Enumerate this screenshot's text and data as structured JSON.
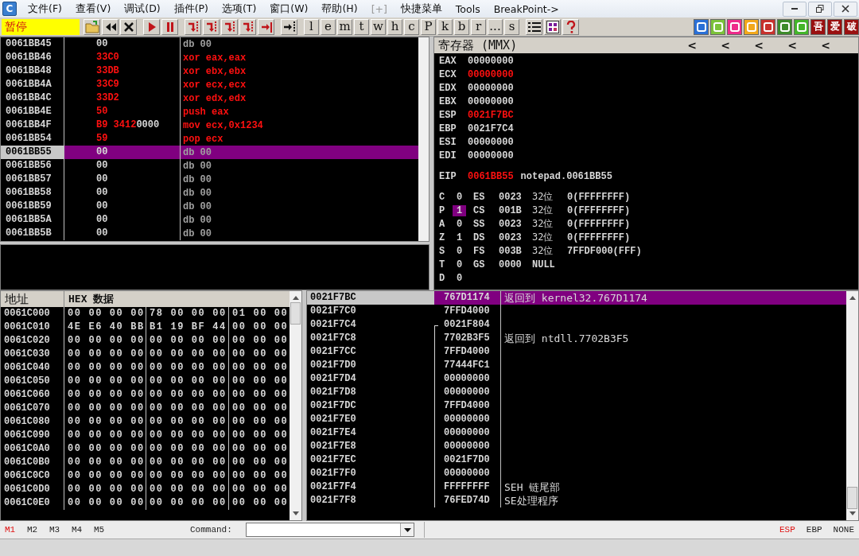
{
  "app_icon": "C",
  "menu": [
    {
      "label": "文件(F)",
      "disabled": false
    },
    {
      "label": "查看(V)",
      "disabled": false
    },
    {
      "label": "调试(D)",
      "disabled": false
    },
    {
      "label": "插件(P)",
      "disabled": false
    },
    {
      "label": "选项(T)",
      "disabled": false
    },
    {
      "label": "窗口(W)",
      "disabled": false
    },
    {
      "label": "帮助(H)",
      "disabled": false
    },
    {
      "label": "[+]",
      "disabled": true
    },
    {
      "label": "快捷菜单",
      "disabled": false
    },
    {
      "label": "Tools",
      "disabled": false
    },
    {
      "label": "BreakPoint->",
      "disabled": false
    }
  ],
  "toolbar": {
    "status": "暂停",
    "letter_buttons": [
      "l",
      "e",
      "m",
      "t",
      "w",
      "h",
      "c",
      "P",
      "k",
      "b",
      "r",
      "...",
      "s"
    ],
    "plugin_buttons": [
      "吾",
      "爱",
      "破"
    ]
  },
  "disassembly": {
    "rows": [
      {
        "address": "0061BB45",
        "hex": [
          {
            "text": "00",
            "modified": false
          }
        ],
        "instruction": "db 00",
        "modified": false,
        "selected": false
      },
      {
        "address": "0061BB46",
        "hex": [
          {
            "text": "33C0",
            "modified": true
          }
        ],
        "instruction": "xor eax,eax",
        "modified": true,
        "selected": false
      },
      {
        "address": "0061BB48",
        "hex": [
          {
            "text": "33DB",
            "modified": true
          }
        ],
        "instruction": "xor ebx,ebx",
        "modified": true,
        "selected": false
      },
      {
        "address": "0061BB4A",
        "hex": [
          {
            "text": "33C9",
            "modified": true
          }
        ],
        "instruction": "xor ecx,ecx",
        "modified": true,
        "selected": false
      },
      {
        "address": "0061BB4C",
        "hex": [
          {
            "text": "33D2",
            "modified": true
          }
        ],
        "instruction": "xor edx,edx",
        "modified": true,
        "selected": false
      },
      {
        "address": "0061BB4E",
        "hex": [
          {
            "text": "50",
            "modified": true
          }
        ],
        "instruction": "push eax",
        "modified": true,
        "selected": false
      },
      {
        "address": "0061BB4F",
        "hex": [
          {
            "text": "B9 3412",
            "modified": true
          },
          {
            "text": "0000",
            "modified": false
          }
        ],
        "instruction": "mov ecx,0x1234",
        "modified": true,
        "selected": false
      },
      {
        "address": "0061BB54",
        "hex": [
          {
            "text": "59",
            "modified": true
          }
        ],
        "instruction": "pop ecx",
        "modified": true,
        "selected": false
      },
      {
        "address": "0061BB55",
        "hex": [
          {
            "text": "00",
            "modified": false
          }
        ],
        "instruction": "db 00",
        "modified": false,
        "selected": true
      },
      {
        "address": "0061BB56",
        "hex": [
          {
            "text": "00",
            "modified": false
          }
        ],
        "instruction": "db 00",
        "modified": false,
        "selected": false
      },
      {
        "address": "0061BB57",
        "hex": [
          {
            "text": "00",
            "modified": false
          }
        ],
        "instruction": "db 00",
        "modified": false,
        "selected": false
      },
      {
        "address": "0061BB58",
        "hex": [
          {
            "text": "00",
            "modified": false
          }
        ],
        "instruction": "db 00",
        "modified": false,
        "selected": false
      },
      {
        "address": "0061BB59",
        "hex": [
          {
            "text": "00",
            "modified": false
          }
        ],
        "instruction": "db 00",
        "modified": false,
        "selected": false
      },
      {
        "address": "0061BB5A",
        "hex": [
          {
            "text": "00",
            "modified": false
          }
        ],
        "instruction": "db 00",
        "modified": false,
        "selected": false
      },
      {
        "address": "0061BB5B",
        "hex": [
          {
            "text": "00",
            "modified": false
          }
        ],
        "instruction": "db 00",
        "modified": false,
        "selected": false
      }
    ]
  },
  "registers": {
    "title": "寄存器 (MMX)",
    "arrows": [
      "<",
      "<",
      "<",
      "<",
      "<"
    ],
    "gprs": [
      {
        "name": "EAX",
        "value": "00000000",
        "changed": false
      },
      {
        "name": "ECX",
        "value": "00000000",
        "changed": true
      },
      {
        "name": "EDX",
        "value": "00000000",
        "changed": false
      },
      {
        "name": "EBX",
        "value": "00000000",
        "changed": false
      },
      {
        "name": "ESP",
        "value": "0021F7BC",
        "changed": true
      },
      {
        "name": "EBP",
        "value": "0021F7C4",
        "changed": false
      },
      {
        "name": "ESI",
        "value": "00000000",
        "changed": false
      },
      {
        "name": "EDI",
        "value": "00000000",
        "changed": false
      }
    ],
    "eip": {
      "name": "EIP",
      "value": "0061BB55",
      "changed": true,
      "comment": "notepad.0061BB55"
    },
    "flags": [
      {
        "name": "C",
        "value": "0",
        "changed": false
      },
      {
        "name": "P",
        "value": "1",
        "changed": true
      },
      {
        "name": "A",
        "value": "0",
        "changed": false
      },
      {
        "name": "Z",
        "value": "1",
        "changed": false
      },
      {
        "name": "S",
        "value": "0",
        "changed": false
      },
      {
        "name": "T",
        "value": "0",
        "changed": false
      },
      {
        "name": "D",
        "value": "0",
        "changed": false
      }
    ],
    "segments": [
      {
        "name": "ES",
        "selector": "0023",
        "bits": "32位",
        "base": "0(FFFFFFFF)"
      },
      {
        "name": "CS",
        "selector": "001B",
        "bits": "32位",
        "base": "0(FFFFFFFF)"
      },
      {
        "name": "SS",
        "selector": "0023",
        "bits": "32位",
        "base": "0(FFFFFFFF)"
      },
      {
        "name": "DS",
        "selector": "0023",
        "bits": "32位",
        "base": "0(FFFFFFFF)"
      },
      {
        "name": "FS",
        "selector": "003B",
        "bits": "32位",
        "base": "7FFDF000(FFF)"
      },
      {
        "name": "GS",
        "selector": "0000",
        "base": "NULL"
      }
    ]
  },
  "dump": {
    "columns": [
      "地址",
      "HEX 数据"
    ],
    "rows": [
      {
        "address": "0061C000",
        "bytes": [
          "00 00 00 00",
          "78 00 00 00",
          "01 00 00"
        ]
      },
      {
        "address": "0061C010",
        "bytes": [
          "4E E6 40 BB",
          "B1 19 BF 44",
          "00 00 00"
        ]
      },
      {
        "address": "0061C020",
        "bytes": [
          "00 00 00 00",
          "00 00 00 00",
          "00 00 00"
        ]
      },
      {
        "address": "0061C030",
        "bytes": [
          "00 00 00 00",
          "00 00 00 00",
          "00 00 00"
        ]
      },
      {
        "address": "0061C040",
        "bytes": [
          "00 00 00 00",
          "00 00 00 00",
          "00 00 00"
        ]
      },
      {
        "address": "0061C050",
        "bytes": [
          "00 00 00 00",
          "00 00 00 00",
          "00 00 00"
        ]
      },
      {
        "address": "0061C060",
        "bytes": [
          "00 00 00 00",
          "00 00 00 00",
          "00 00 00"
        ]
      },
      {
        "address": "0061C070",
        "bytes": [
          "00 00 00 00",
          "00 00 00 00",
          "00 00 00"
        ]
      },
      {
        "address": "0061C080",
        "bytes": [
          "00 00 00 00",
          "00 00 00 00",
          "00 00 00"
        ]
      },
      {
        "address": "0061C090",
        "bytes": [
          "00 00 00 00",
          "00 00 00 00",
          "00 00 00"
        ]
      },
      {
        "address": "0061C0A0",
        "bytes": [
          "00 00 00 00",
          "00 00 00 00",
          "00 00 00"
        ]
      },
      {
        "address": "0061C0B0",
        "bytes": [
          "00 00 00 00",
          "00 00 00 00",
          "00 00 00"
        ]
      },
      {
        "address": "0061C0C0",
        "bytes": [
          "00 00 00 00",
          "00 00 00 00",
          "00 00 00"
        ]
      },
      {
        "address": "0061C0D0",
        "bytes": [
          "00 00 00 00",
          "00 00 00 00",
          "00 00 00"
        ]
      },
      {
        "address": "0061C0E0",
        "bytes": [
          "00 00 00 00",
          "00 00 00 00",
          "00 00 00"
        ]
      }
    ]
  },
  "stack": {
    "rows": [
      {
        "address": "0021F7BC",
        "value": "767D1174",
        "comment": "返回到 kernel32.767D1174",
        "selected": true,
        "chain_start": false
      },
      {
        "address": "0021F7C0",
        "value": "7FFD4000",
        "selected": false,
        "chain_start": false
      },
      {
        "address": "0021F7C4",
        "value": "0021F804",
        "selected": false,
        "chain_start": true
      },
      {
        "address": "0021F7C8",
        "value": "7702B3F5",
        "comment": "返回到 ntdll.7702B3F5",
        "selected": false,
        "chain_start": false
      },
      {
        "address": "0021F7CC",
        "value": "7FFD4000",
        "selected": false,
        "chain_start": false
      },
      {
        "address": "0021F7D0",
        "value": "77444FC1",
        "selected": false,
        "chain_start": false
      },
      {
        "address": "0021F7D4",
        "value": "00000000",
        "selected": false,
        "chain_start": false
      },
      {
        "address": "0021F7D8",
        "value": "00000000",
        "selected": false,
        "chain_start": false
      },
      {
        "address": "0021F7DC",
        "value": "7FFD4000",
        "selected": false,
        "chain_start": false
      },
      {
        "address": "0021F7E0",
        "value": "00000000",
        "selected": false,
        "chain_start": false
      },
      {
        "address": "0021F7E4",
        "value": "00000000",
        "selected": false,
        "chain_start": false
      },
      {
        "address": "0021F7E8",
        "value": "00000000",
        "selected": false,
        "chain_start": false
      },
      {
        "address": "0021F7EC",
        "value": "0021F7D0",
        "selected": false,
        "chain_start": false
      },
      {
        "address": "0021F7F0",
        "value": "00000000",
        "selected": false,
        "chain_start": false
      },
      {
        "address": "0021F7F4",
        "value": "FFFFFFFF",
        "comment": "SEH 链尾部",
        "selected": false,
        "chain_start": false
      },
      {
        "address": "0021F7F8",
        "value": "76FED74D",
        "comment": "SE处理程序",
        "selected": false,
        "chain_start": false
      }
    ]
  },
  "bottom_bar": {
    "tabs": [
      {
        "label": "M1",
        "selected": true
      },
      {
        "label": "M2",
        "selected": false
      },
      {
        "label": "M3",
        "selected": false
      },
      {
        "label": "M4",
        "selected": false
      },
      {
        "label": "M5",
        "selected": false
      }
    ],
    "command_label": "Command:",
    "stack_modes": [
      {
        "label": "ESP",
        "selected": true
      },
      {
        "label": "EBP",
        "selected": false
      },
      {
        "label": "NONE",
        "selected": false
      }
    ]
  }
}
